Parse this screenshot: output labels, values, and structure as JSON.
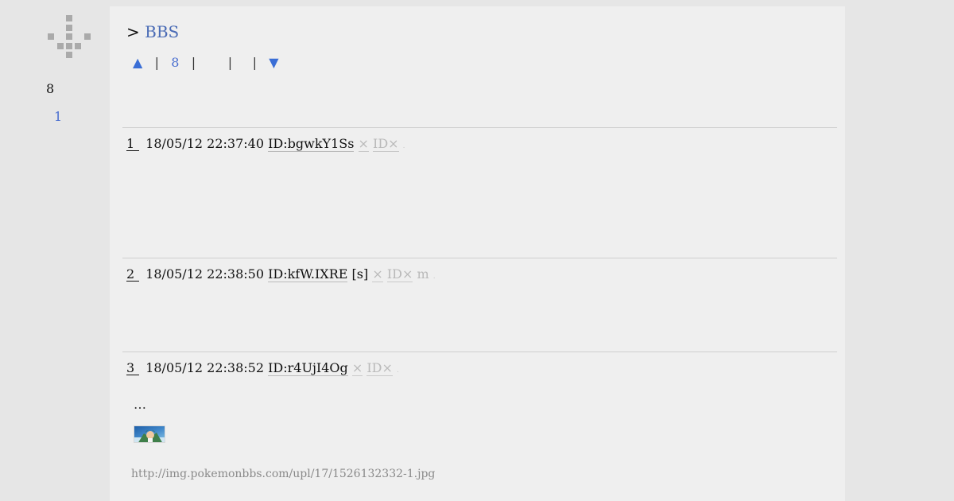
{
  "sidebar": {
    "count": "8",
    "page_link": "1"
  },
  "header": {
    "prompt": ">",
    "board_link": "BBS"
  },
  "nav": {
    "up": "▲",
    "sep": "|",
    "page": "8",
    "down": "▼"
  },
  "posts": [
    {
      "number": "1",
      "datetime": "18/05/12 22:37:40",
      "id": "ID:bgwkY1Ss",
      "tag": "",
      "delete": "×",
      "id_delete": "ID×",
      "extra": "",
      "dot": "."
    },
    {
      "number": "2",
      "datetime": "18/05/12 22:38:50",
      "id": "ID:kfW.IXRE",
      "tag": "[s]",
      "delete": "×",
      "id_delete": "ID×",
      "extra": "m",
      "dot": "."
    },
    {
      "number": "3",
      "datetime": "18/05/12 22:38:52",
      "id": "ID:r4UjI4Og",
      "tag": "",
      "delete": "×",
      "id_delete": "ID×",
      "extra": "",
      "dot": ".",
      "body": "…",
      "image_url": "http://img.pokemonbbs.com/upl/17/1526132332-1.jpg"
    }
  ]
}
